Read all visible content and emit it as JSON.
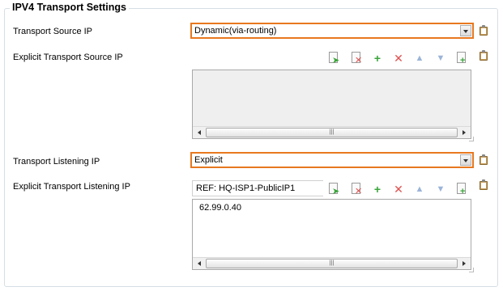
{
  "section": {
    "title": "IPV4 Transport Settings"
  },
  "fields": {
    "transport_source_ip": {
      "label": "Transport Source IP",
      "value": "Dynamic(via-routing)"
    },
    "explicit_transport_source_ip": {
      "label": "Explicit Transport Source IP",
      "items": []
    },
    "transport_listening_ip": {
      "label": "Transport Listening IP",
      "value": "Explicit"
    },
    "explicit_transport_listening_ip": {
      "label": "Explicit Transport Listening IP",
      "ref_value": "REF: HQ-ISP1-PublicIP1",
      "items": [
        "62.99.0.40"
      ]
    }
  },
  "toolbar_icons": [
    "insert-icon",
    "delete-entry-icon",
    "add-icon",
    "remove-icon",
    "move-up-icon",
    "move-down-icon",
    "add-document-icon"
  ],
  "colors": {
    "focus_border": "#e8781f",
    "add": "#3aa53a",
    "remove": "#e05050"
  }
}
